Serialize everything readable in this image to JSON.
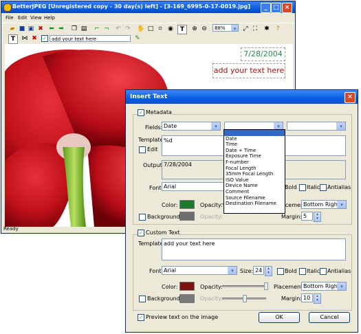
{
  "main": {
    "title": "BetterJPEG [Unregistered copy - 30 day(s) left] - [3-169_6995-0-17-0019.jpg]",
    "menu": [
      "File",
      "Edit",
      "View",
      "Help"
    ],
    "zoom": "88%",
    "text_field": "add your text here",
    "status": "Ready",
    "overlay_date": "7/28/2004",
    "overlay_text": "add your text here",
    "title_buttons": {
      "minimize": "_",
      "maximize": "□",
      "close": "×"
    }
  },
  "dialog": {
    "title": "Insert Text",
    "close": "×",
    "metadata": {
      "checkbox_label": "Metadata",
      "checked": true,
      "fields_label": "Fields:",
      "field1": "Date",
      "field2": "",
      "field3": "",
      "template_label": "Template:",
      "template_value": "%d",
      "edit_label": "Edit",
      "output_label": "Output:",
      "output_value": "7/28/2004",
      "font_label": "Font:",
      "font_value": "Arial",
      "bold": "Bold",
      "italic": "Italic",
      "antialias": "Antialias",
      "color_label": "Color:",
      "color": "#1f7a2e",
      "opacity_label": "Opacity:",
      "placement_label": "Placement:",
      "placement_visible": "acement:",
      "placement_value": "Bottom Right",
      "background_label": "Background:",
      "bg_color": "#6e6e6e",
      "margin_label": "Margin:",
      "margin_value": "5"
    },
    "field_options": [
      "",
      "Date",
      "Time",
      "Date + Time",
      "Exposure Time",
      "F-number",
      "Focal Length",
      "35mm Focal Length",
      "ISO Value",
      "Device Name",
      "Comment",
      "Source Filename",
      "Destination Filename"
    ],
    "custom": {
      "checkbox_label": "Custom Text",
      "checked": true,
      "template_label": "Template:",
      "template_value": "add your text here",
      "font_label": "Font:",
      "font_value": "Arial",
      "size_label": "Size:",
      "size_value": "24",
      "bold": "Bold",
      "italic": "Italic",
      "antialias": "Antialias",
      "color_label": "Color:",
      "color": "#7a1212",
      "opacity_label": "Opacity:",
      "placement_label": "Placement:",
      "placement_value": "Bottom Right",
      "background_label": "Background:",
      "bg_color": "#7a7a7a",
      "margin_label": "Margin:",
      "margin_value": "10"
    },
    "preview_label": "Preview text on the image",
    "preview_checked": true,
    "ok": "OK",
    "cancel": "Cancel"
  },
  "colors": {
    "titlebar": "#0a5ce0",
    "dialog_bg": "#ece9d8",
    "selection": "#316ac5"
  }
}
